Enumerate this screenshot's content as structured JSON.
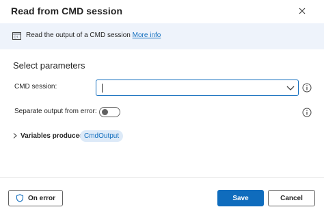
{
  "dialog": {
    "title": "Read from CMD session",
    "info": {
      "text": "Read the output of a CMD session ",
      "link": "More info",
      "icon": "cmd-window-icon"
    }
  },
  "parameters": {
    "section_title": "Select parameters",
    "cmd_session": {
      "label": "CMD session:",
      "value": "",
      "placeholder": ""
    },
    "separate_output": {
      "label": "Separate output from error:",
      "on": false
    },
    "variables": {
      "label": "Variables produced",
      "chips": [
        "CmdOutput"
      ]
    }
  },
  "footer": {
    "on_error_label": "On error",
    "save_label": "Save",
    "cancel_label": "Cancel"
  },
  "colors": {
    "accent": "#0f6cbd",
    "info_bar_bg": "#eef3fb",
    "chip_bg": "#ddeaf8"
  }
}
